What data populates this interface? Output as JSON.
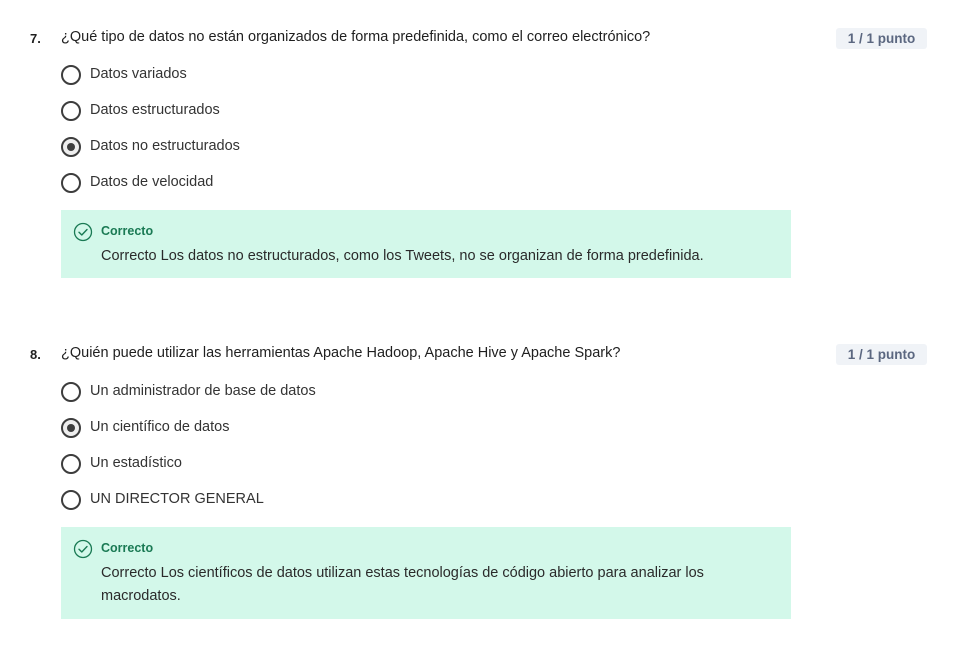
{
  "questions": [
    {
      "number": "7.",
      "text": "¿Qué tipo de datos no están organizados de forma predefinida, como el correo electrónico?",
      "points": "1 / 1 punto",
      "options": [
        {
          "label": "Datos variados",
          "selected": false
        },
        {
          "label": "Datos estructurados",
          "selected": false
        },
        {
          "label": "Datos no estructurados",
          "selected": true
        },
        {
          "label": "Datos de velocidad",
          "selected": false
        }
      ],
      "feedback": {
        "title": "Correcto",
        "text": "Correcto Los datos no estructurados, como los Tweets, no se organizan de forma predefinida."
      }
    },
    {
      "number": "8.",
      "text": "¿Quién puede utilizar las herramientas Apache Hadoop, Apache Hive y Apache Spark?",
      "points": "1 / 1 punto",
      "options": [
        {
          "label": "Un administrador de base de datos",
          "selected": false
        },
        {
          "label": "Un científico de datos",
          "selected": true
        },
        {
          "label": "Un estadístico",
          "selected": false
        },
        {
          "label": "UN DIRECTOR GENERAL",
          "selected": false
        }
      ],
      "feedback": {
        "title": "Correcto",
        "text": "Correcto Los científicos de datos utilizan estas tecnologías de código abierto para analizar los macrodatos."
      }
    }
  ],
  "colors": {
    "feedback_background": "#d3f8ea",
    "correct_accent": "#1a7a54",
    "points_badge_background": "#f0f3f7",
    "points_badge_text": "#5b6780"
  },
  "icons": {
    "correct": "check-circle-icon",
    "radio_selected": "radio-checked-icon",
    "radio_unselected": "radio-unchecked-icon"
  }
}
